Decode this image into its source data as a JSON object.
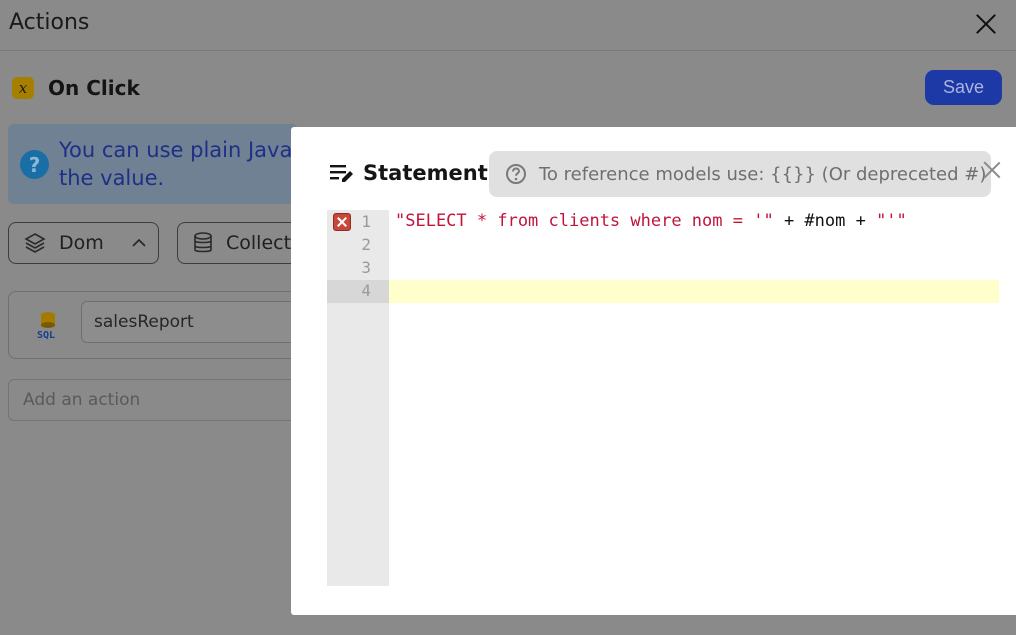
{
  "background": {
    "title": "Actions",
    "event_label": "On Click",
    "save_label": "Save",
    "info_text": "You can use plain JavaScript to set the value.",
    "chips": [
      {
        "label": "Dom"
      },
      {
        "label": "Collecti"
      }
    ],
    "action": {
      "name": "salesReport",
      "icon_label": "SQL"
    },
    "add_action_placeholder": "Add an action"
  },
  "modal": {
    "title": "Statement",
    "hint": "To reference models use: {{}} (Or depreceted #)",
    "code_lines": [
      {
        "num": "1",
        "str1": "\"SELECT * from clients where nom = '\"",
        "mid": " + #nom + ",
        "str2": "\"'\""
      },
      {
        "num": "2"
      },
      {
        "num": "3"
      },
      {
        "num": "4"
      }
    ]
  },
  "colors": {
    "accent": "#1d39a6",
    "string_token": "#c1143b",
    "active_line": "#ffffcc"
  }
}
